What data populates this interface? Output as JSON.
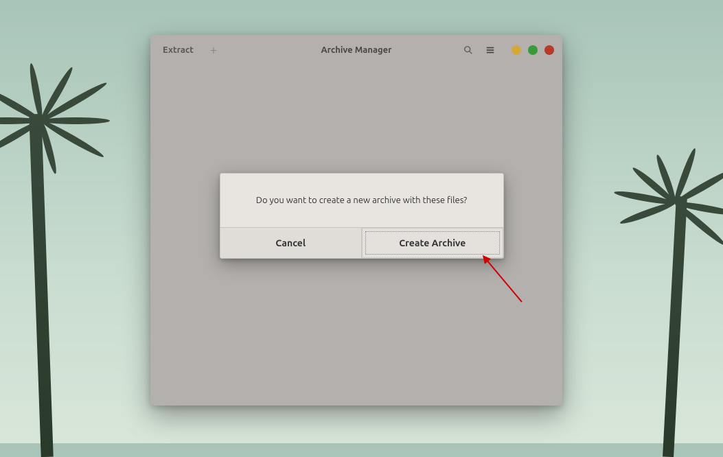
{
  "window": {
    "title": "Archive Manager",
    "toolbar": {
      "extract_label": "Extract",
      "add_label": "+"
    },
    "controls": {
      "minimize_color": "#d4a938",
      "maximize_color": "#3a9a3a",
      "close_color": "#b83a2a"
    }
  },
  "dialog": {
    "message": "Do you want to create a new archive with these files?",
    "cancel_label": "Cancel",
    "create_label": "Create Archive"
  }
}
